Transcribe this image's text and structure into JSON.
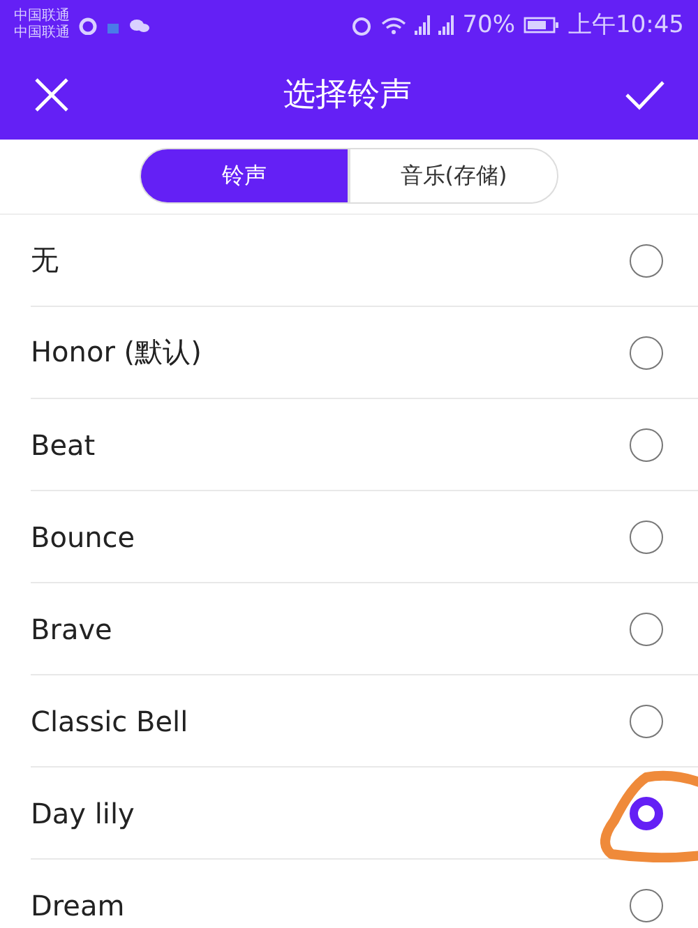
{
  "status_bar": {
    "carriers": [
      "中国联通",
      "中国联通"
    ],
    "battery_text": "70%",
    "time": "上午10:45"
  },
  "header": {
    "title": "选择铃声"
  },
  "tabs": [
    {
      "label": "铃声",
      "selected": true
    },
    {
      "label": "音乐(存储)",
      "selected": false
    }
  ],
  "ringtones": [
    {
      "name": "无",
      "selected": false
    },
    {
      "name": "Honor (默认)",
      "selected": false
    },
    {
      "name": "Beat",
      "selected": false
    },
    {
      "name": "Bounce",
      "selected": false
    },
    {
      "name": "Brave",
      "selected": false
    },
    {
      "name": "Classic Bell",
      "selected": false
    },
    {
      "name": "Day lily",
      "selected": true,
      "annotated": true
    },
    {
      "name": "Dream",
      "selected": false
    }
  ]
}
